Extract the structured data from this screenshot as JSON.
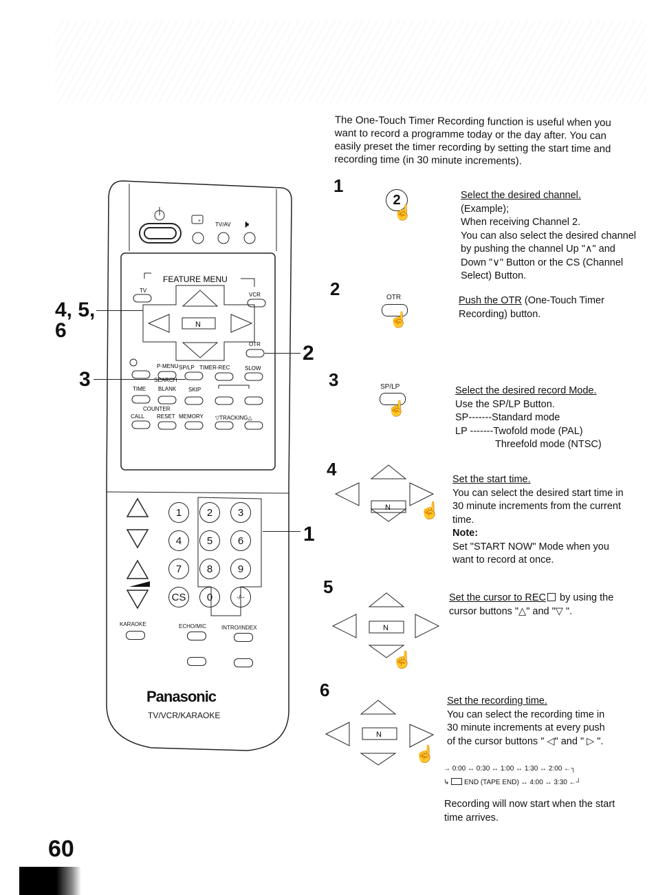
{
  "page": {
    "number": "60",
    "intro": "The One-Touch Timer Recording function is useful when you want to record a programme today or the day after. You can easily preset the timer recording by setting the start time and recording time (in 30 minute increments)."
  },
  "remote": {
    "brand": "Panasonic",
    "model": "TV/VCR/KARAOKE",
    "top_labels": {
      "tvav": "TV/AV"
    },
    "feature_menu": "FEATURE MENU",
    "tv": "TV",
    "vcr": "VCR",
    "n": "N",
    "otr": "OTR",
    "row1": [
      "P-MENU",
      "SP/LP",
      "TIMER-REC",
      "SLOW"
    ],
    "search": "SEARCH",
    "row2": [
      "TIME",
      "BLANK",
      "SKIP"
    ],
    "minus": "-",
    "plus": "+",
    "counter": "COUNTER",
    "row3": [
      "CALL",
      "RESET",
      "MEMORY",
      "▽TRACKING△"
    ],
    "keypad": [
      "1",
      "2",
      "3",
      "4",
      "5",
      "6",
      "7",
      "8",
      "9",
      "CS",
      "0",
      "-/--"
    ],
    "karaoke": "KARAOKE",
    "echo_mic": "ECHO/MIC",
    "intro_index": "INTRO/INDEX",
    "callouts": {
      "c456": "4, 5,\n6",
      "c456a": "4, 5,",
      "c456b": "6",
      "c3": "3",
      "c2": "2",
      "c1": "1"
    }
  },
  "steps": [
    {
      "num": "1",
      "icon_label": "2",
      "heading": "Select the desired channel.",
      "lines": [
        "(Example);",
        "When receiving Channel 2.",
        "You can also select the desired channel by pushing the channel Up \"∧\" and Down \"∨\" Button or the CS (Channel Select) Button."
      ]
    },
    {
      "num": "2",
      "icon_label": "OTR",
      "heading": "Push the OTR",
      "lines": [
        " (One-Touch Timer Recording) button."
      ]
    },
    {
      "num": "3",
      "icon_label": "SP/LP",
      "heading": "Select the desired record Mode.",
      "lines": [
        "Use the SP/LP Button.",
        "SP-------Standard mode",
        "LP -------Twofold mode (PAL)",
        "Threefold mode (NTSC)"
      ]
    },
    {
      "num": "4",
      "icon_label": "N",
      "heading": "Set the start time.",
      "lines": [
        "You can select the desired start time in 30 minute increments from the current time."
      ],
      "note_label": "Note:",
      "note": "Set \"START NOW\" Mode when you want to record at once."
    },
    {
      "num": "5",
      "icon_label": "N",
      "heading": "Set the cursor to REC",
      "lines": [
        " by using the cursor buttons \"△\" and \"▽ \"."
      ]
    },
    {
      "num": "6",
      "icon_label": "N",
      "heading": "Set the recording time.",
      "lines": [
        "You can select the recording time in 30 minute increments at every push of the cursor buttons \" ◁\" and \" ▷ \"."
      ],
      "timeline_row1": "0:00 ↔ 0:30 ↔ 1:00 ↔ 1:30 ↔ 2:00",
      "timeline_row2": "END (TAPE END) ↔ 4:00 ↔ 3:30",
      "footer": "Recording will now start when the start time arrives."
    }
  ]
}
